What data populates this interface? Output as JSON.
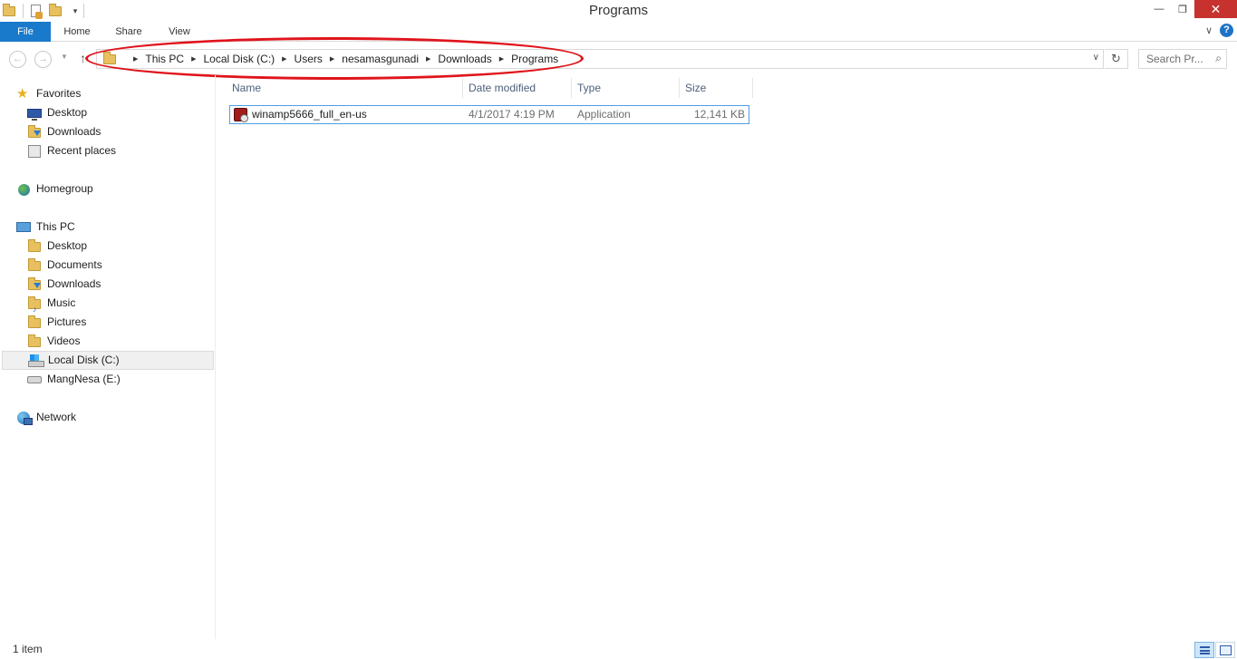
{
  "window": {
    "title": "Programs",
    "controls": {
      "minimize": "—",
      "restore": "❐",
      "close": "✕"
    },
    "accent_color": "#1979ca",
    "close_color": "#c7312e"
  },
  "quick_access": {
    "dropdown": "▾"
  },
  "ribbon": {
    "tabs": [
      {
        "label": "File"
      },
      {
        "label": "Home"
      },
      {
        "label": "Share"
      },
      {
        "label": "View"
      }
    ],
    "expand": "∨",
    "help": "?"
  },
  "navigation": {
    "back": "←",
    "forward": "→",
    "recent": "▼",
    "up": "↑",
    "breadcrumbs": [
      "This PC",
      "Local Disk (C:)",
      "Users",
      "nesamasgunadi",
      "Downloads",
      "Programs"
    ],
    "crumb_separator": "▶",
    "address_dropdown": "∨",
    "refresh": "↻",
    "search_placeholder": "Search Pr...",
    "search_glyph": "⌕",
    "annotation_color": "#e0141b"
  },
  "nav_pane": {
    "favorites": {
      "label": "Favorites",
      "glyph": "★",
      "items": [
        "Desktop",
        "Downloads",
        "Recent places"
      ]
    },
    "homegroup": {
      "label": "Homegroup"
    },
    "this_pc": {
      "label": "This PC",
      "items": [
        "Desktop",
        "Documents",
        "Downloads",
        "Music",
        "Pictures",
        "Videos",
        "Local Disk (C:)",
        "MangNesa (E:)"
      ],
      "selected": "Local Disk (C:)"
    },
    "network": {
      "label": "Network"
    },
    "music_glyph": "♪"
  },
  "file_list": {
    "columns": [
      "Name",
      "Date modified",
      "Type",
      "Size"
    ],
    "rows": [
      {
        "name": "winamp5666_full_en-us",
        "date_modified": "4/1/2017 4:19 PM",
        "type": "Application",
        "size": "12,141 KB"
      }
    ]
  },
  "status_bar": {
    "item_count": "1 item"
  }
}
